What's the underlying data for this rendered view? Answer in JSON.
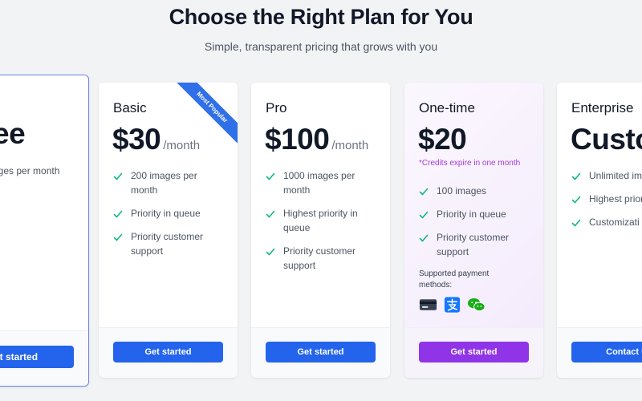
{
  "header": {
    "title": "Choose the Right Plan for You",
    "subtitle": "Simple, transparent pricing that grows with you"
  },
  "colors": {
    "primary_button": "#2463eb",
    "one_time_button": "#8f34e6",
    "check": "#10b981",
    "credits_note": "#a33bdb"
  },
  "plans": [
    {
      "price_visible": "ee",
      "feature_visible": "ages per month",
      "button": "et started"
    },
    {
      "name": "Basic",
      "price": "$30",
      "per": "/month",
      "ribbon": "Most Popular",
      "features": [
        "200 images per month",
        "Priority in queue",
        "Priority customer support"
      ],
      "button": "Get started"
    },
    {
      "name": "Pro",
      "price": "$100",
      "per": "/month",
      "features": [
        "1000 images per month",
        "Highest priority in queue",
        "Priority customer support"
      ],
      "button": "Get started"
    },
    {
      "name": "One-time",
      "price": "$20",
      "note": "*Credits expire in one month",
      "features": [
        "100 images",
        "Priority in queue",
        "Priority customer support"
      ],
      "payment_label": "Supported payment methods:",
      "payment_icons": [
        "credit-card-icon",
        "alipay-icon",
        "wechat-pay-icon"
      ],
      "button": "Get started"
    },
    {
      "name": "Enterprise",
      "price": "Custo",
      "features": [
        "Unlimited im month",
        "Highest prior queue",
        "Customizati access"
      ],
      "button": "Contact u"
    }
  ]
}
